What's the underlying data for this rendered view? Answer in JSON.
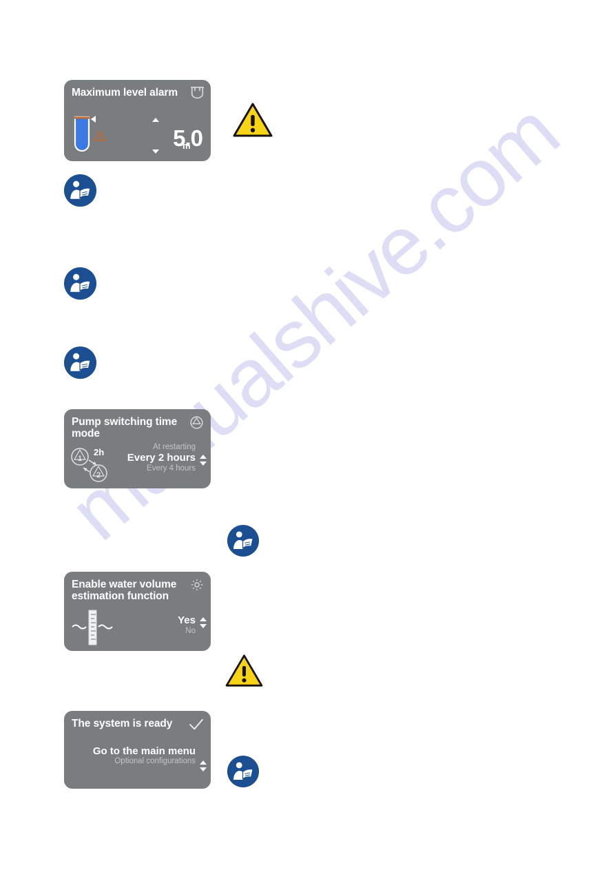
{
  "page": {
    "watermark": "manualshive.com",
    "background_color": "#ffffff",
    "panel_color": "#7a7d80"
  },
  "panels": [
    {
      "id": "maximum-level-alarm",
      "title": "Maximum level alarm",
      "corner_icon": "tank-icon",
      "graphic": "tank-level-warning-graphic",
      "value": "5.0",
      "unit": "m"
    },
    {
      "id": "pump-switching-time-mode",
      "title": "Pump switching time mode",
      "corner_icon": "pump-icon",
      "graphic": "pump-alternation-graphic",
      "graphic_label": "2h",
      "pump_labels": [
        "1",
        "2"
      ],
      "option_above": "At restarting",
      "option_selected": "Every 2 hours",
      "option_below": "Every 4 hours"
    },
    {
      "id": "water-volume-estimation",
      "title": "Enable water volume estimation function",
      "corner_icon": "gear-icon",
      "graphic": "water-level-gauge-graphic",
      "option_selected": "Yes",
      "option_below": "No"
    },
    {
      "id": "system-ready",
      "title": "The system is ready",
      "corner_icon": "check-icon",
      "option_selected": "Go to the main menu",
      "option_below": "Optional configurations"
    }
  ],
  "safety_icons": [
    {
      "name": "warning-triangle-icon",
      "label": "warning"
    },
    {
      "name": "read-instructions-icon",
      "label": "read instructions"
    },
    {
      "name": "read-instructions-icon",
      "label": "read instructions"
    },
    {
      "name": "read-instructions-icon",
      "label": "read instructions"
    },
    {
      "name": "read-instructions-icon",
      "label": "read instructions"
    },
    {
      "name": "warning-triangle-icon",
      "label": "warning"
    },
    {
      "name": "read-instructions-icon",
      "label": "read instructions"
    }
  ],
  "colors": {
    "panel": "#7a7d80",
    "warning_yellow": "#f8d417",
    "mandatory_blue": "#1b4f92",
    "water_blue": "#3b7ae4",
    "tank_accent": "#c06a2c"
  }
}
